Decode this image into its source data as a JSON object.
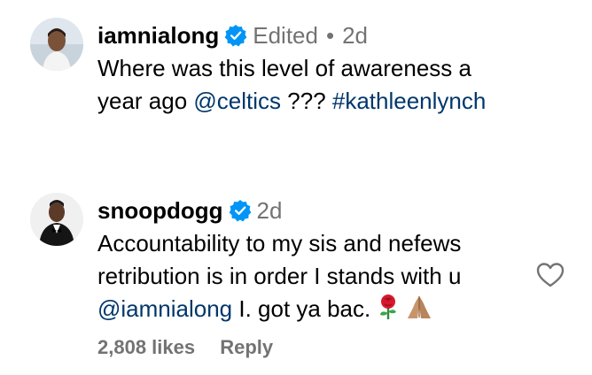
{
  "colors": {
    "text": "#000000",
    "secondary": "#737373",
    "link": "#00376b",
    "verified": "#0095f6"
  },
  "comments": [
    {
      "username": "iamnialong",
      "verified_icon": "verified-badge-icon",
      "edited": "Edited",
      "separator": "•",
      "time": "2d",
      "text_line1": "Where was this level of awareness a",
      "text_line2_plain": "year ago ",
      "mention": "@celtics",
      "text_line2_mid": " ??? ",
      "hashtag": "#kathleenlynch"
    },
    {
      "username": "snoopdogg",
      "verified_icon": "verified-badge-icon",
      "time": "2d",
      "text_line1": "Accountability to my sis and nefews",
      "text_line2": "retribution is in order I stands with u",
      "mention": "@iamnialong",
      "text_line3_rest": " I. got ya bac.",
      "emojis": [
        "rose-icon",
        "folded-hands-icon"
      ],
      "likes": "2,808 likes",
      "reply": "Reply",
      "like_icon": "heart-icon"
    }
  ]
}
